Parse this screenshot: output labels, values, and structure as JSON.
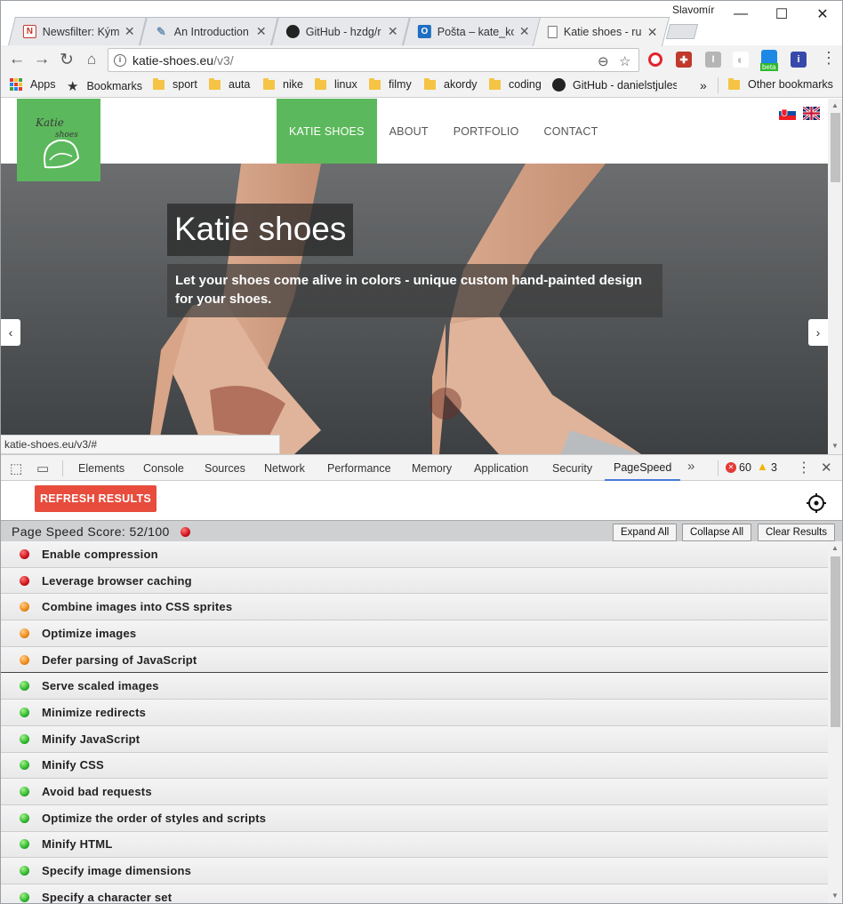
{
  "browser": {
    "profile_name": "Slavomír",
    "tabs": [
      {
        "title": "Newsfilter: Kým",
        "icon": "newsfilter-icon"
      },
      {
        "title": "An Introduction",
        "icon": "web-icon"
      },
      {
        "title": "GitHub - hzdg/r",
        "icon": "github-icon"
      },
      {
        "title": "Pošta – kate_ko",
        "icon": "outlook-icon"
      },
      {
        "title": "Katie shoes - ru",
        "icon": "page-icon",
        "active": true
      }
    ],
    "url_host": "katie-shoes.eu",
    "url_path": "/v3/",
    "bookmarks": [
      {
        "label": "Apps",
        "icon": "apps-icon"
      },
      {
        "label": "Bookmarks",
        "icon": "star-icon"
      },
      {
        "label": "sport",
        "icon": "folder-icon"
      },
      {
        "label": "auta",
        "icon": "folder-icon"
      },
      {
        "label": "nike",
        "icon": "folder-icon"
      },
      {
        "label": "linux",
        "icon": "folder-icon"
      },
      {
        "label": "filmy",
        "icon": "folder-icon"
      },
      {
        "label": "akordy",
        "icon": "folder-icon"
      },
      {
        "label": "coding",
        "icon": "folder-icon"
      },
      {
        "label": "GitHub - danielstjules",
        "icon": "github-icon"
      }
    ],
    "bookmarks_overflow": "»",
    "other_bookmarks": "Other bookmarks",
    "extension_beta_badge": "beta",
    "status_url": "katie-shoes.eu/v3/#"
  },
  "site": {
    "nav": [
      "KATIE SHOES",
      "ABOUT",
      "PORTFOLIO",
      "CONTACT"
    ],
    "hero_title": "Katie shoes",
    "hero_subtitle": "Let your shoes come alive in colors - unique custom hand-painted design for your shoes.",
    "brand_color": "#5cb85c"
  },
  "devtools": {
    "tabs": [
      "Elements",
      "Console",
      "Sources",
      "Network",
      "Performance",
      "Memory",
      "Application",
      "Security",
      "PageSpeed"
    ],
    "active_tab": "PageSpeed",
    "error_count": "60",
    "warning_count": "3"
  },
  "pagespeed": {
    "refresh_label": "REFRESH RESULTS",
    "score_label": "Page Speed Score: 52/100",
    "score": 52,
    "expand_all": "Expand All",
    "collapse_all": "Collapse All",
    "clear_results": "Clear Results",
    "rules": [
      {
        "label": "Enable compression",
        "status": "red"
      },
      {
        "label": "Leverage browser caching",
        "status": "red"
      },
      {
        "label": "Combine images into CSS sprites",
        "status": "orange"
      },
      {
        "label": "Optimize images",
        "status": "orange"
      },
      {
        "label": "Defer parsing of JavaScript",
        "status": "orange"
      },
      {
        "label": "Serve scaled images",
        "status": "green"
      },
      {
        "label": "Minimize redirects",
        "status": "green"
      },
      {
        "label": "Minify JavaScript",
        "status": "green"
      },
      {
        "label": "Minify CSS",
        "status": "green"
      },
      {
        "label": "Avoid bad requests",
        "status": "green"
      },
      {
        "label": "Optimize the order of styles and scripts",
        "status": "green"
      },
      {
        "label": "Minify HTML",
        "status": "green"
      },
      {
        "label": "Specify image dimensions",
        "status": "green"
      },
      {
        "label": "Specify a character set",
        "status": "green"
      }
    ]
  }
}
